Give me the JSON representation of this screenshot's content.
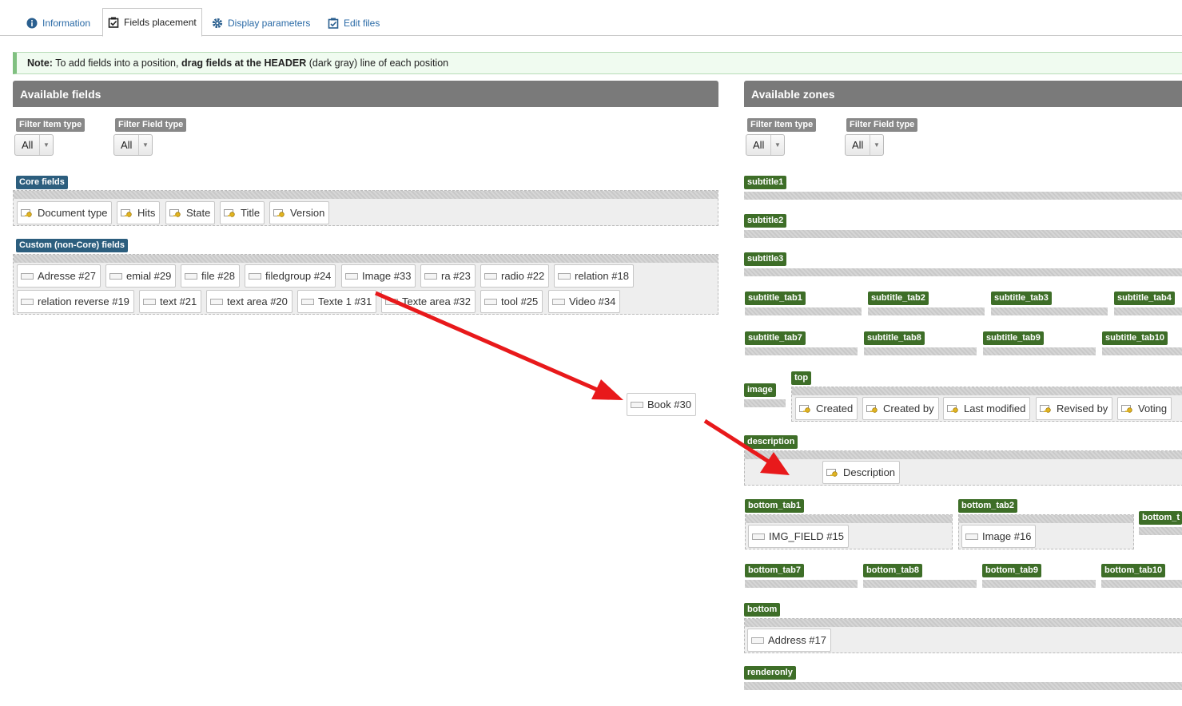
{
  "tabs": [
    {
      "label": "Information",
      "icon": "info-icon"
    },
    {
      "label": "Fields placement",
      "icon": "checkbox-icon"
    },
    {
      "label": "Display parameters",
      "icon": "gear-icon"
    },
    {
      "label": "Edit files",
      "icon": "checkbox-icon"
    }
  ],
  "note": {
    "prefix": "Note:",
    "text1": " To add fields into a position, ",
    "bold": "drag fields at the HEADER",
    "text2": " (dark gray) line of each position"
  },
  "available_fields": {
    "title": "Available fields",
    "filter_item_label": "Filter Item type",
    "filter_item_value": "All",
    "filter_field_label": "Filter Field type",
    "filter_field_value": "All",
    "core_label": "Core fields",
    "core_fields": [
      "Document type",
      "Hits",
      "State",
      "Title",
      "Version"
    ],
    "custom_label": "Custom (non-Core) fields",
    "custom_fields_row1": [
      "Adresse #27",
      "emial #29",
      "file #28",
      "filedgroup #24",
      "Image #33",
      "ra #23",
      "radio #22",
      "relation #18"
    ],
    "custom_fields_row2": [
      "relation reverse #19",
      "text #21",
      "text area #20",
      "Texte 1 #31",
      "Texte area #32",
      "tool #25",
      "Video #34"
    ]
  },
  "dragged_field": "Book #30",
  "available_zones": {
    "title": "Available zones",
    "filter_item_label": "Filter Item type",
    "filter_item_value": "All",
    "filter_field_label": "Filter Field type",
    "filter_field_value": "All",
    "subtitle1": "subtitle1",
    "subtitle2": "subtitle2",
    "subtitle3": "subtitle3",
    "subtitle_tabs_row1": [
      "subtitle_tab1",
      "subtitle_tab2",
      "subtitle_tab3",
      "subtitle_tab4"
    ],
    "subtitle_tabs_row2": [
      "subtitle_tab7",
      "subtitle_tab8",
      "subtitle_tab9",
      "subtitle_tab10"
    ],
    "image": "image",
    "top": "top",
    "top_fields": [
      "Created",
      "Created by",
      "Last modified",
      "Revised by",
      "Voting"
    ],
    "description": "description",
    "description_field": "Description",
    "bottom_tab1": "bottom_tab1",
    "bottom_tab1_field": "IMG_FIELD #15",
    "bottom_tab2": "bottom_tab2",
    "bottom_tab2_field": "Image #16",
    "bottom_tab3_partial": "bottom_t",
    "bottom_tabs_row2": [
      "bottom_tab7",
      "bottom_tab8",
      "bottom_tab9",
      "bottom_tab10"
    ],
    "bottom": "bottom",
    "bottom_field": "Address #17",
    "renderonly": "renderonly"
  },
  "colors": {
    "arrow": "#e8191b",
    "zone_label": "#3e6e28",
    "group_label": "#2c5e7e",
    "header": "#7a7a7a"
  }
}
